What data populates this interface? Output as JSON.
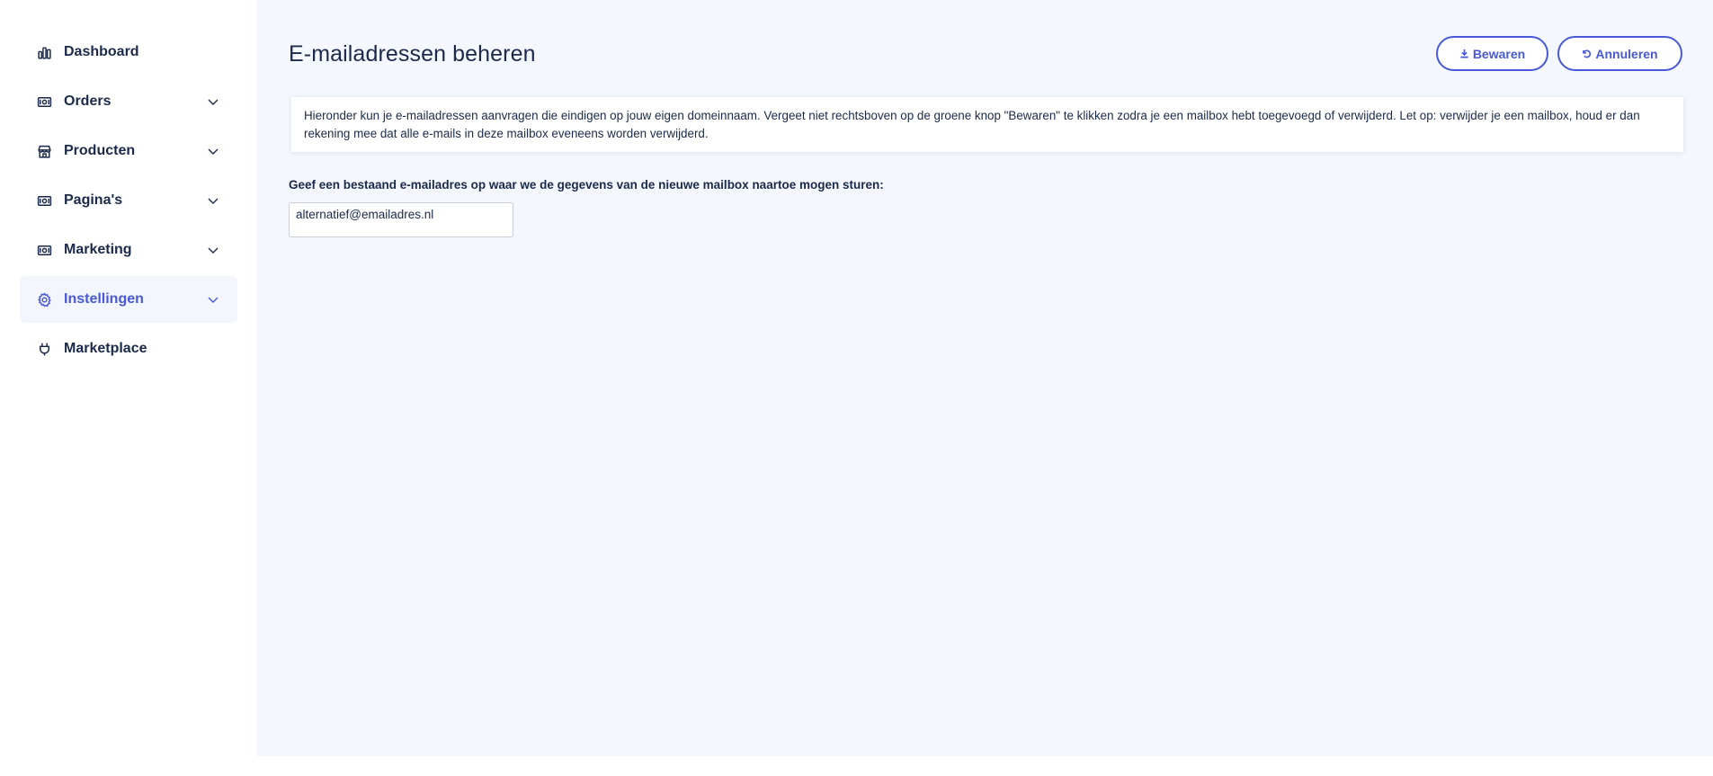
{
  "sidebar": {
    "items": [
      {
        "label": "Dashboard",
        "icon": "bar-chart-icon",
        "has_chevron": false,
        "active": false
      },
      {
        "label": "Orders",
        "icon": "banknote-icon",
        "has_chevron": true,
        "active": false
      },
      {
        "label": "Producten",
        "icon": "store-icon",
        "has_chevron": true,
        "active": false
      },
      {
        "label": "Pagina's",
        "icon": "banknote-icon",
        "has_chevron": true,
        "active": false
      },
      {
        "label": "Marketing",
        "icon": "banknote-icon",
        "has_chevron": true,
        "active": false
      },
      {
        "label": "Instellingen",
        "icon": "gear-icon",
        "has_chevron": true,
        "active": true
      },
      {
        "label": "Marketplace",
        "icon": "plug-icon",
        "has_chevron": false,
        "active": false
      }
    ]
  },
  "header": {
    "title": "E-mailadressen beheren",
    "save_label": "Bewaren",
    "cancel_label": "Annuleren"
  },
  "info": {
    "text": "Hieronder kun je e-mailadressen aanvragen die eindigen op jouw eigen domeinnaam. Vergeet niet rechtsboven op de groene knop \"Bewaren\" te klikken zodra je een mailbox hebt toegevoegd of verwijderd. Let op: verwijder je een mailbox, houd er dan rekening mee dat alle e-mails in deze mailbox eveneens worden verwijderd."
  },
  "form": {
    "label": "Geef een bestaand e-mailadres op waar we de gegevens van de nieuwe mailbox naartoe mogen sturen:",
    "value": "alternatief@emailadres.nl"
  },
  "colors": {
    "accent": "#4858d8",
    "text": "#1b2a4a",
    "main_background": "#f4f7fd",
    "active_item_background": "#f3f6fc"
  }
}
